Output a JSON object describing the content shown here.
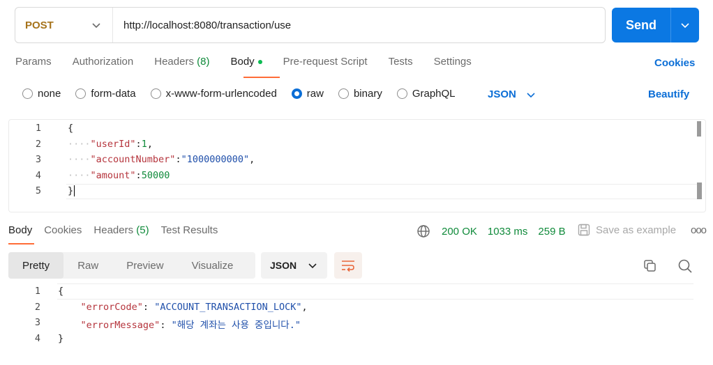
{
  "request": {
    "method": "POST",
    "url": "http://localhost:8080/transaction/use",
    "send_label": "Send"
  },
  "req_tabs": {
    "params": "Params",
    "authorization": "Authorization",
    "headers": "Headers",
    "headers_count": "(8)",
    "body": "Body",
    "prerequest": "Pre-request Script",
    "tests": "Tests",
    "settings": "Settings",
    "cookies": "Cookies"
  },
  "body_types": {
    "none": "none",
    "form_data": "form-data",
    "urlencoded": "x-www-form-urlencoded",
    "raw": "raw",
    "binary": "binary",
    "graphql": "GraphQL",
    "selected": "raw",
    "language": "JSON",
    "beautify": "Beautify"
  },
  "editor": {
    "line_numbers": [
      "1",
      "2",
      "3",
      "4",
      "5"
    ],
    "l1": "{",
    "l2_key": "\"userId\"",
    "l2_val": "1",
    "l3_key": "\"accountNumber\"",
    "l3_val": "\"1000000000\"",
    "l4_key": "\"amount\"",
    "l4_val": "50000",
    "l5": "}"
  },
  "response": {
    "tabs": {
      "body": "Body",
      "cookies": "Cookies",
      "headers": "Headers",
      "headers_count": "(5)",
      "test_results": "Test Results"
    },
    "status": "200 OK",
    "time": "1033 ms",
    "size": "259 B",
    "save_example": "Save as example",
    "more": "ooo",
    "view_tabs": {
      "pretty": "Pretty",
      "raw": "Raw",
      "preview": "Preview",
      "visualize": "Visualize"
    },
    "format": "JSON",
    "line_numbers": [
      "1",
      "2",
      "3",
      "4"
    ],
    "l1": "{",
    "l2_key": "\"errorCode\"",
    "l2_val": "\"ACCOUNT_TRANSACTION_LOCK\"",
    "l3_key": "\"errorMessage\"",
    "l3_val": "\"해당 계좌는 사용 중입니다.\"",
    "l4": "}"
  },
  "colors": {
    "send": "#0b78e3",
    "accent": "#ff6c37",
    "link": "#0b6ed6",
    "success": "#0f8a3a",
    "method": "#a6731b"
  }
}
